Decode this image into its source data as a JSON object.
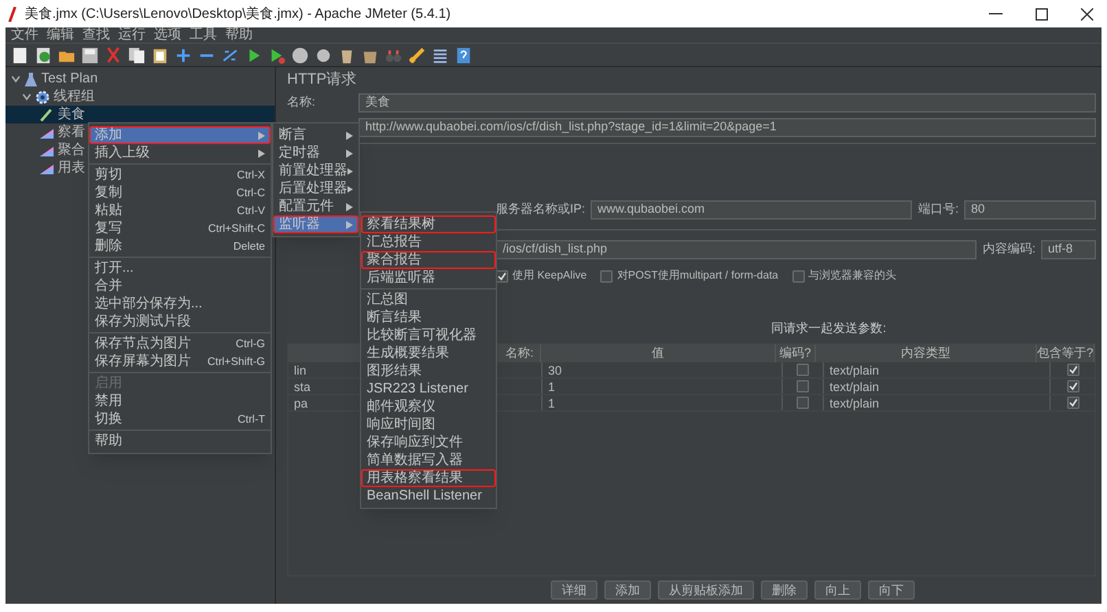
{
  "window": {
    "title": "美食.jmx (C:\\Users\\Lenovo\\Desktop\\美食.jmx) - Apache JMeter (5.4.1)"
  },
  "menu_bar": [
    "文件",
    "编辑",
    "查找",
    "运行",
    "选项",
    "工具",
    "帮助"
  ],
  "tree": [
    {
      "kind": "plan",
      "label": "Test Plan",
      "expanded": true,
      "selected": false,
      "children": [
        {
          "kind": "thread_group",
          "label": "线程组",
          "expanded": true,
          "selected": false,
          "children": [
            {
              "kind": "sampler",
              "label": "美食",
              "selected": true
            },
            {
              "kind": "listener",
              "label": "察看",
              "selected": false
            },
            {
              "kind": "listener",
              "label": "聚合",
              "selected": false
            },
            {
              "kind": "listener",
              "label": "用表",
              "selected": false
            }
          ]
        }
      ]
    }
  ],
  "context_menu": [
    {
      "kind": "item",
      "label": "添加",
      "submenu": true,
      "selected": true,
      "marked": true,
      "disabled": false
    },
    {
      "kind": "item",
      "label": "插入上级",
      "submenu": true,
      "selected": false,
      "marked": false,
      "disabled": false
    },
    {
      "kind": "separator"
    },
    {
      "kind": "item",
      "label": "剪切",
      "shortcut": "Ctrl-X",
      "submenu": false,
      "selected": false,
      "marked": false,
      "disabled": false
    },
    {
      "kind": "item",
      "label": "复制",
      "shortcut": "Ctrl-C",
      "submenu": false,
      "selected": false,
      "marked": false,
      "disabled": false
    },
    {
      "kind": "item",
      "label": "粘贴",
      "shortcut": "Ctrl-V",
      "submenu": false,
      "selected": false,
      "marked": false,
      "disabled": false
    },
    {
      "kind": "item",
      "label": "复写",
      "shortcut": "Ctrl+Shift-C",
      "submenu": false,
      "selected": false,
      "marked": false,
      "disabled": false
    },
    {
      "kind": "item",
      "label": "删除",
      "shortcut": "Delete",
      "submenu": false,
      "selected": false,
      "marked": false,
      "disabled": false
    },
    {
      "kind": "separator"
    },
    {
      "kind": "item",
      "label": "打开...",
      "submenu": false,
      "selected": false,
      "marked": false,
      "disabled": false
    },
    {
      "kind": "item",
      "label": "合并",
      "submenu": false,
      "selected": false,
      "marked": false,
      "disabled": false
    },
    {
      "kind": "item",
      "label": "选中部分保存为...",
      "submenu": false,
      "selected": false,
      "marked": false,
      "disabled": false
    },
    {
      "kind": "item",
      "label": "保存为测试片段",
      "submenu": false,
      "selected": false,
      "marked": false,
      "disabled": false
    },
    {
      "kind": "separator"
    },
    {
      "kind": "item",
      "label": "保存节点为图片",
      "shortcut": "Ctrl-G",
      "submenu": false,
      "selected": false,
      "marked": false,
      "disabled": false
    },
    {
      "kind": "item",
      "label": "保存屏幕为图片",
      "shortcut": "Ctrl+Shift-G",
      "submenu": false,
      "selected": false,
      "marked": false,
      "disabled": false
    },
    {
      "kind": "separator"
    },
    {
      "kind": "item",
      "label": "启用",
      "submenu": false,
      "selected": false,
      "marked": false,
      "disabled": true
    },
    {
      "kind": "item",
      "label": "禁用",
      "submenu": false,
      "selected": false,
      "marked": false,
      "disabled": false
    },
    {
      "kind": "item",
      "label": "切换",
      "shortcut": "Ctrl-T",
      "submenu": false,
      "selected": false,
      "marked": false,
      "disabled": false
    },
    {
      "kind": "separator"
    },
    {
      "kind": "item",
      "label": "帮助",
      "submenu": false,
      "selected": false,
      "marked": false,
      "disabled": false
    }
  ],
  "add_submenu": [
    {
      "kind": "item",
      "label": "断言",
      "submenu": true,
      "selected": false,
      "marked": false,
      "disabled": false
    },
    {
      "kind": "item",
      "label": "定时器",
      "submenu": true,
      "selected": false,
      "marked": false,
      "disabled": false
    },
    {
      "kind": "item",
      "label": "前置处理器",
      "submenu": true,
      "selected": false,
      "marked": false,
      "disabled": false
    },
    {
      "kind": "item",
      "label": "后置处理器",
      "submenu": true,
      "selected": false,
      "marked": false,
      "disabled": false
    },
    {
      "kind": "item",
      "label": "配置元件",
      "submenu": true,
      "selected": false,
      "marked": false,
      "disabled": false
    },
    {
      "kind": "item",
      "label": "监听器",
      "submenu": true,
      "selected": true,
      "marked": true,
      "disabled": false
    }
  ],
  "listener_submenu": [
    {
      "kind": "item",
      "label": "察看结果树",
      "submenu": false,
      "selected": false,
      "marked": true,
      "disabled": false
    },
    {
      "kind": "item",
      "label": "汇总报告",
      "submenu": false,
      "selected": false,
      "marked": false,
      "disabled": false
    },
    {
      "kind": "item",
      "label": "聚合报告",
      "submenu": false,
      "selected": false,
      "marked": true,
      "disabled": false
    },
    {
      "kind": "item",
      "label": "后端监听器",
      "submenu": false,
      "selected": false,
      "marked": false,
      "disabled": false
    },
    {
      "kind": "separator"
    },
    {
      "kind": "item",
      "label": "汇总图",
      "submenu": false,
      "selected": false,
      "marked": false,
      "disabled": false
    },
    {
      "kind": "item",
      "label": "断言结果",
      "submenu": false,
      "selected": false,
      "marked": false,
      "disabled": false
    },
    {
      "kind": "item",
      "label": "比较断言可视化器",
      "submenu": false,
      "selected": false,
      "marked": false,
      "disabled": false
    },
    {
      "kind": "item",
      "label": "生成概要结果",
      "submenu": false,
      "selected": false,
      "marked": false,
      "disabled": false
    },
    {
      "kind": "item",
      "label": "图形结果",
      "submenu": false,
      "selected": false,
      "marked": false,
      "disabled": false
    },
    {
      "kind": "item",
      "label": "JSR223 Listener",
      "submenu": false,
      "selected": false,
      "marked": false,
      "disabled": false
    },
    {
      "kind": "item",
      "label": "邮件观察仪",
      "submenu": false,
      "selected": false,
      "marked": false,
      "disabled": false
    },
    {
      "kind": "item",
      "label": "响应时间图",
      "submenu": false,
      "selected": false,
      "marked": false,
      "disabled": false
    },
    {
      "kind": "item",
      "label": "保存响应到文件",
      "submenu": false,
      "selected": false,
      "marked": false,
      "disabled": false
    },
    {
      "kind": "item",
      "label": "简单数据写入器",
      "submenu": false,
      "selected": false,
      "marked": false,
      "disabled": false
    },
    {
      "kind": "item",
      "label": "用表格察看结果",
      "submenu": false,
      "selected": false,
      "marked": true,
      "disabled": false
    },
    {
      "kind": "item",
      "label": "BeanShell Listener",
      "submenu": false,
      "selected": false,
      "marked": false,
      "disabled": false
    }
  ],
  "panel": {
    "title": "HTTP请求",
    "name": {
      "label": "名称:",
      "value": "美食"
    },
    "comment": {
      "value": "http://www.qubaobei.com/ios/cf/dish_list.php?stage_id=1&limit=20&page=1"
    },
    "server": {
      "label": "服务器名称或IP:",
      "value": "www.qubaobei.com"
    },
    "port": {
      "label": "端口号:",
      "value": "80"
    },
    "path": {
      "value": "/ios/cf/dish_list.php"
    },
    "encoding": {
      "label": "内容编码:",
      "value": "utf-8"
    },
    "options": [
      {
        "label": "使用 KeepAlive",
        "checked": true
      },
      {
        "label": "对POST使用multipart / form-data",
        "checked": false
      },
      {
        "label": "与浏览器兼容的头",
        "checked": false
      }
    ],
    "params": {
      "title": "同请求一起发送参数:",
      "columns": [
        "名称:",
        "值",
        "编码?",
        "内容类型",
        "包含等于?"
      ],
      "rows": [
        {
          "name": "lin",
          "value": "30",
          "encode": false,
          "content_type": "text/plain",
          "include_equals": true
        },
        {
          "name": "sta",
          "value": "1",
          "encode": false,
          "content_type": "text/plain",
          "include_equals": true
        },
        {
          "name": "pa",
          "value": "1",
          "encode": false,
          "content_type": "text/plain",
          "include_equals": true
        }
      ]
    },
    "buttons": [
      "详细",
      "添加",
      "从剪贴板添加",
      "删除",
      "向上",
      "向下"
    ]
  }
}
